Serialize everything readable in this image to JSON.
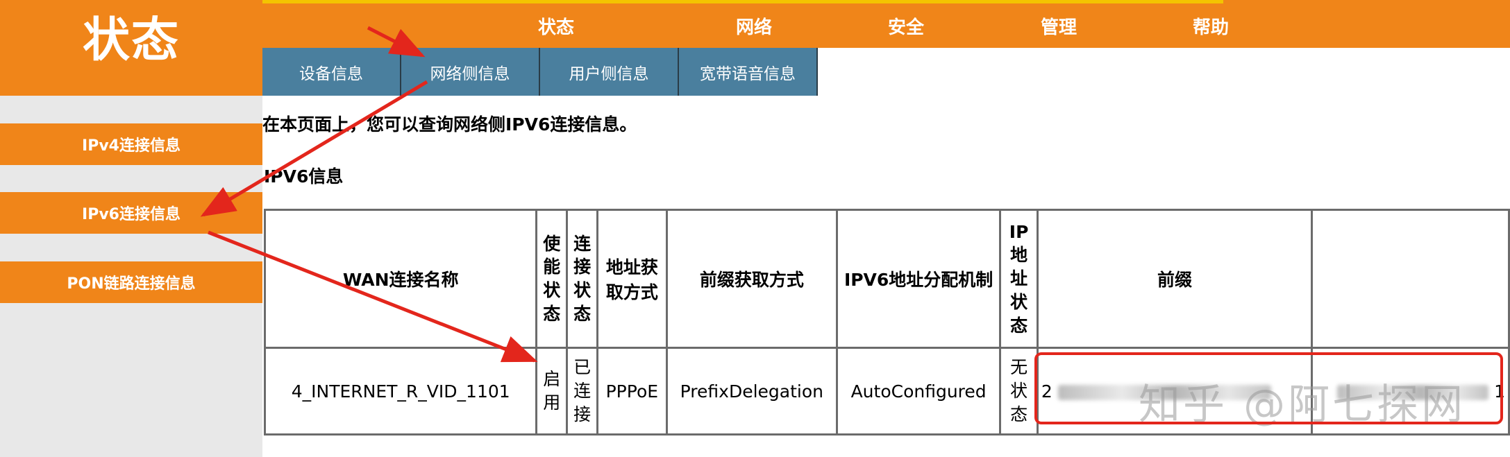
{
  "header": {
    "logo_title": "状态"
  },
  "topnav": {
    "items": [
      {
        "label": "状态"
      },
      {
        "label": "网络"
      },
      {
        "label": "安全"
      },
      {
        "label": "管理"
      },
      {
        "label": "帮助"
      }
    ]
  },
  "subnav": {
    "tabs": [
      {
        "label": "设备信息"
      },
      {
        "label": "网络侧信息"
      },
      {
        "label": "用户侧信息"
      },
      {
        "label": "宽带语音信息"
      }
    ]
  },
  "sidebar": {
    "items": [
      {
        "label": "IPv4连接信息"
      },
      {
        "label": "IPv6连接信息"
      },
      {
        "label": "PON链路连接信息"
      }
    ]
  },
  "main": {
    "intro_text": "在本页面上，您可以查询网络侧IPV6连接信息。",
    "section_title": "IPV6信息",
    "table": {
      "headers": [
        "WAN连接名称",
        "使能状态",
        "连接状态",
        "地址获取方式",
        "前缀获取方式",
        "IPV6地址分配机制",
        "IP地址状态",
        "前缀",
        ""
      ],
      "rows": [
        [
          "4_INTERNET_R_VID_1101",
          "启用",
          "已连接",
          "PPPoE",
          "PrefixDelegation",
          "AutoConfigured",
          "无状态",
          "2",
          "1"
        ]
      ]
    }
  },
  "watermark": "知乎 @阿七探网",
  "colors": {
    "accent": "#f08519",
    "tab": "#4a7f9e",
    "annotation": "#e3261c",
    "top_strip": "#f4c400"
  }
}
